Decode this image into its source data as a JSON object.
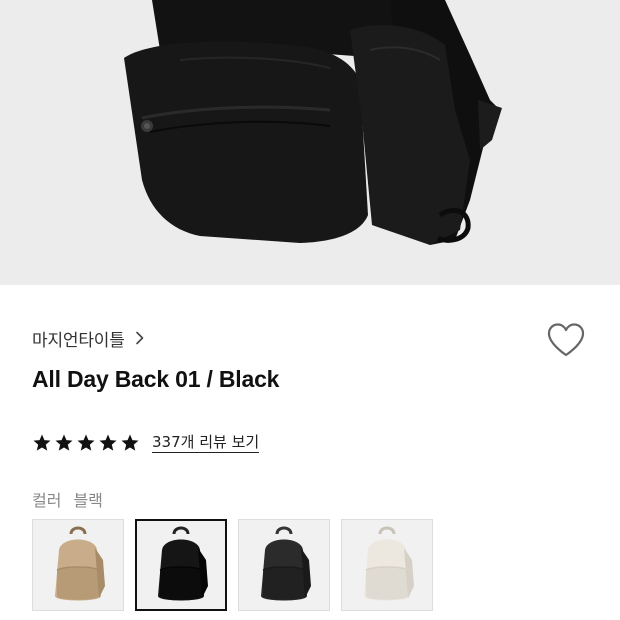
{
  "product": {
    "brand": "마지언타이틀",
    "title": "All Day Back 01 / Black",
    "rating_stars": 5,
    "review_link": "337개 리뷰 보기",
    "option_label": "컬러",
    "option_value": "블랙",
    "wishlisted": false
  },
  "swatches": [
    {
      "color_name": "beige",
      "body": "#c9ad8a",
      "shade": "#a88c68",
      "strap": "#8a6f4f",
      "selected": false
    },
    {
      "color_name": "black",
      "body": "#151515",
      "shade": "#050505",
      "strap": "#222222",
      "selected": true
    },
    {
      "color_name": "charcoal",
      "body": "#2b2b2b",
      "shade": "#1a1a1a",
      "strap": "#333333",
      "selected": false
    },
    {
      "color_name": "ivory",
      "body": "#ece7df",
      "shade": "#d6d0c6",
      "strap": "#c9c2b7",
      "selected": false
    }
  ],
  "icons": {
    "brand_chevron": "chevron-right-icon",
    "wishlist": "heart-outline-icon",
    "rating": "star-filled-icon"
  },
  "colors": {
    "hero_background": "#ececec",
    "star": "#111111",
    "muted_text": "#888888"
  }
}
